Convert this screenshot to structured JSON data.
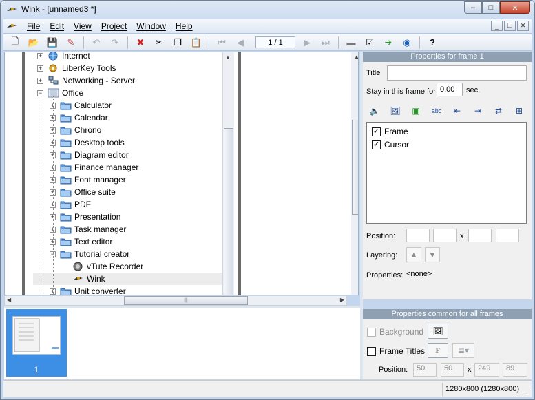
{
  "window": {
    "title": "Wink - [unnamed3 *]",
    "controls": {
      "minimize": "–",
      "maximize": "□",
      "close": "✕"
    }
  },
  "menu": {
    "items": [
      "File",
      "Edit",
      "View",
      "Project",
      "Window",
      "Help"
    ],
    "mdi": {
      "minimize": "_",
      "restore": "❐",
      "close": "✕"
    }
  },
  "toolbar": {
    "buttons": [
      {
        "icon": "new-file-icon",
        "glyph": "🗋"
      },
      {
        "icon": "open-folder-icon",
        "glyph": "📂"
      },
      {
        "icon": "save-icon",
        "glyph": "💾"
      },
      {
        "icon": "render-icon",
        "glyph": "✎"
      },
      {
        "icon": "undo-icon",
        "glyph": "↶"
      },
      {
        "icon": "redo-icon",
        "glyph": "↷"
      },
      {
        "icon": "delete-icon",
        "glyph": "✖"
      },
      {
        "icon": "cut-icon",
        "glyph": "✂"
      },
      {
        "icon": "copy-icon",
        "glyph": "❐"
      },
      {
        "icon": "paste-icon",
        "glyph": "📋"
      },
      {
        "icon": "first-frame-icon",
        "glyph": "⏮"
      },
      {
        "icon": "prev-frame-icon",
        "glyph": "◀"
      },
      {
        "icon": "next-frame-icon",
        "glyph": "▶"
      },
      {
        "icon": "last-frame-icon",
        "glyph": "⏭"
      },
      {
        "icon": "capture-icon",
        "glyph": "▬"
      },
      {
        "icon": "properties-icon",
        "glyph": "☑"
      },
      {
        "icon": "export-arrow-icon",
        "glyph": "➔"
      },
      {
        "icon": "preview-icon",
        "glyph": "◉"
      },
      {
        "icon": "help-icon",
        "glyph": "?"
      }
    ],
    "frame_counter": "1 / 1"
  },
  "tree": {
    "items": [
      {
        "label": "Internet",
        "icon": "globe-icon",
        "level": 0,
        "expander": "+"
      },
      {
        "label": "LiberKey Tools",
        "icon": "gear-icon",
        "level": 0,
        "expander": "+"
      },
      {
        "label": "Networking - Server",
        "icon": "network-icon",
        "level": 0,
        "expander": "+"
      },
      {
        "label": "Office",
        "icon": "office-icon",
        "level": 0,
        "expander": "−"
      },
      {
        "label": "Calculator",
        "icon": "folder-icon",
        "level": 1,
        "expander": "+"
      },
      {
        "label": "Calendar",
        "icon": "folder-icon",
        "level": 1,
        "expander": "+"
      },
      {
        "label": "Chrono",
        "icon": "folder-icon",
        "level": 1,
        "expander": "+"
      },
      {
        "label": "Desktop tools",
        "icon": "folder-icon",
        "level": 1,
        "expander": "+"
      },
      {
        "label": "Diagram editor",
        "icon": "folder-icon",
        "level": 1,
        "expander": "+"
      },
      {
        "label": "Finance manager",
        "icon": "folder-icon",
        "level": 1,
        "expander": "+"
      },
      {
        "label": "Font manager",
        "icon": "folder-icon",
        "level": 1,
        "expander": "+"
      },
      {
        "label": "Office suite",
        "icon": "folder-icon",
        "level": 1,
        "expander": "+"
      },
      {
        "label": "PDF",
        "icon": "folder-icon",
        "level": 1,
        "expander": "+"
      },
      {
        "label": "Presentation",
        "icon": "folder-icon",
        "level": 1,
        "expander": "+"
      },
      {
        "label": "Task manager",
        "icon": "folder-icon",
        "level": 1,
        "expander": "+"
      },
      {
        "label": "Text editor",
        "icon": "folder-icon",
        "level": 1,
        "expander": "+"
      },
      {
        "label": "Tutorial creator",
        "icon": "folder-icon",
        "level": 1,
        "expander": "−"
      },
      {
        "label": "vTute Recorder",
        "icon": "recorder-icon",
        "level": 2,
        "expander": ""
      },
      {
        "label": "Wink",
        "icon": "wink-icon",
        "level": 2,
        "expander": "",
        "selected": true
      },
      {
        "label": "Unit converter",
        "icon": "folder-icon",
        "level": 1,
        "expander": "+"
      }
    ]
  },
  "filmstrip": {
    "frames": [
      {
        "label": "1"
      }
    ]
  },
  "frame_props": {
    "header": "Properties for frame 1",
    "title_label": "Title",
    "title_value": "",
    "stay_label": "Stay in this frame for",
    "stay_value": "0.00",
    "stay_unit": "sec.",
    "items": [
      {
        "label": "Frame",
        "checked": true
      },
      {
        "label": "Cursor",
        "checked": true
      }
    ],
    "position_label": "Position:",
    "position_sep": "x",
    "layering_label": "Layering:",
    "properties_label": "Properties:",
    "properties_value": "<none>"
  },
  "common_props": {
    "header": "Properties common for all frames",
    "background_label": "Background",
    "frame_titles_label": "Frame Titles",
    "font_button": "F",
    "position_label": "Position:",
    "pos": {
      "x1": "50",
      "y1": "50",
      "sep": "x",
      "x2": "249",
      "y2": "89"
    }
  },
  "status": {
    "resolution": "1280x800 (1280x800)"
  }
}
